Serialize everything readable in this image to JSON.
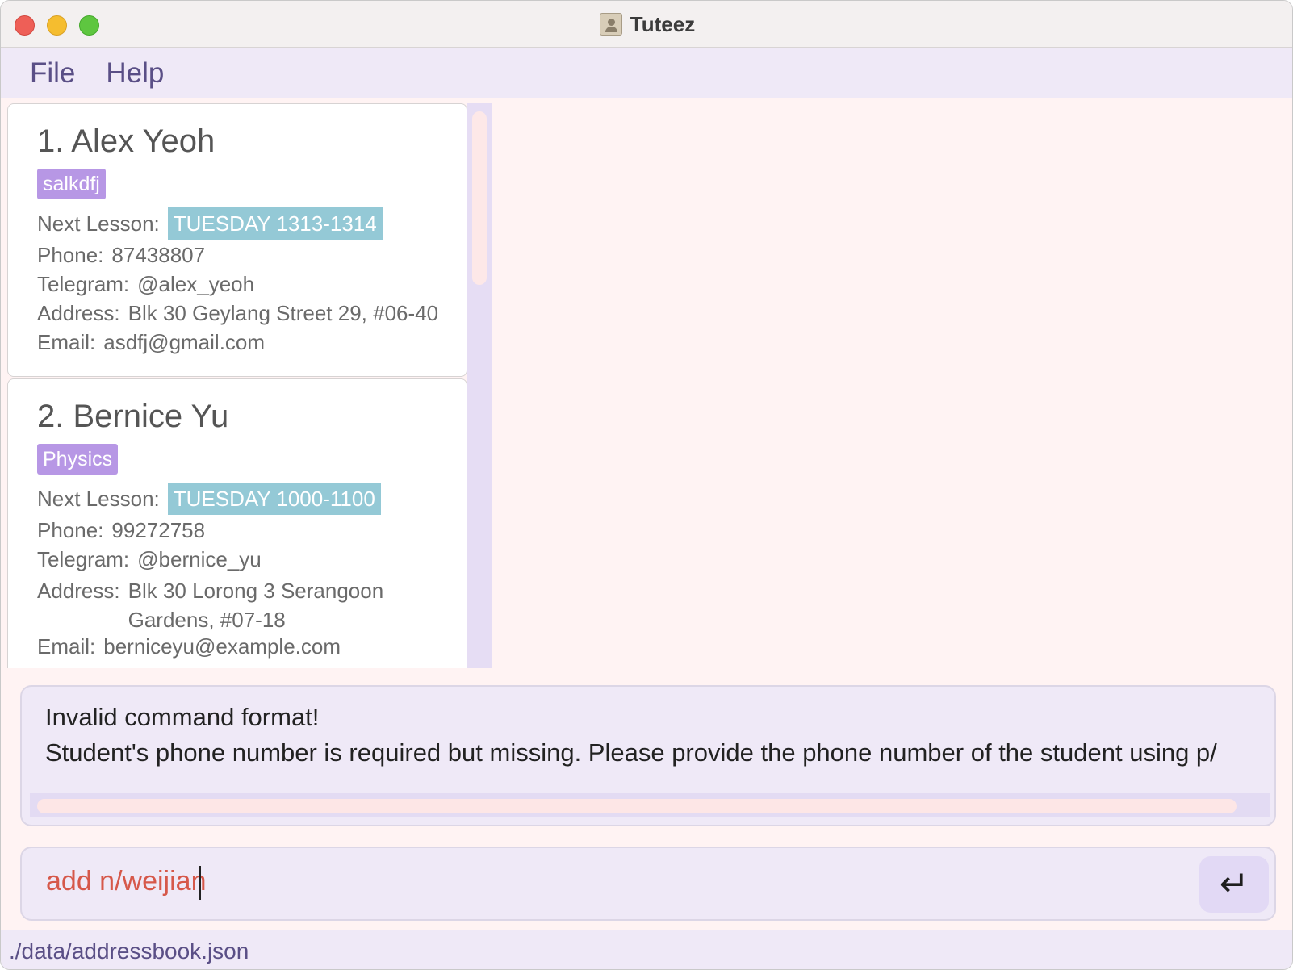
{
  "window": {
    "title": "Tuteez"
  },
  "menu": {
    "items": [
      "File",
      "Help"
    ]
  },
  "students": [
    {
      "name": "1. Alex Yeoh",
      "tag": "salkdfj",
      "next_lesson_label": "Next Lesson:",
      "next_lesson": "TUESDAY 1313-1314",
      "phone_label": "Phone:",
      "phone": "87438807",
      "telegram_label": "Telegram:",
      "telegram": "@alex_yeoh",
      "address_label": "Address:",
      "address": "Blk 30 Geylang Street 29, #06-40",
      "email_label": "Email:",
      "email": "asdfj@gmail.com"
    },
    {
      "name": "2. Bernice Yu",
      "tag": "Physics",
      "next_lesson_label": "Next Lesson:",
      "next_lesson": "TUESDAY 1000-1100",
      "phone_label": "Phone:",
      "phone": "99272758",
      "telegram_label": "Telegram:",
      "telegram": "@bernice_yu",
      "address_label": "Address:",
      "address_line1": "Blk 30 Lorong 3 Serangoon",
      "address_line2": "Gardens, #07-18",
      "email_label": "Email:",
      "email": "berniceyu@example.com"
    }
  ],
  "result": {
    "line1": "Invalid command format!",
    "line2": "Student's phone number is required but missing. Please provide the phone number of the student using p/"
  },
  "command": {
    "value": "add n/weijian",
    "enter_icon": "enter-icon"
  },
  "status": {
    "file_path": "./data/addressbook.json"
  }
}
